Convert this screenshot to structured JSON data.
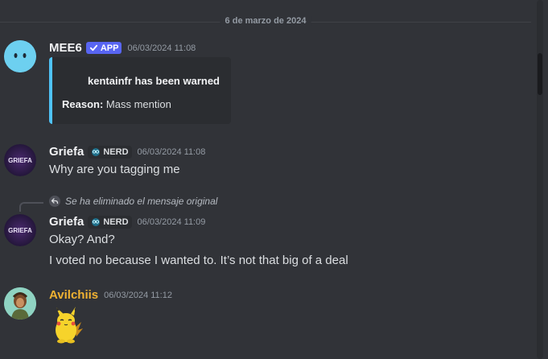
{
  "date_divider": "6 de marzo de 2024",
  "colors": {
    "background": "#313338",
    "embed_accent": "#4fc3f7",
    "app_badge": "#5865f2",
    "avilchiis_name": "#f0b232"
  },
  "messages": [
    {
      "author": "MEE6",
      "badge": "APP",
      "badge_icon": "check-icon",
      "timestamp": "06/03/2024 11:08",
      "embed": {
        "title": "kentainfr has been warned",
        "field_name": "Reason:",
        "field_value": "Mass mention"
      }
    },
    {
      "author": "Griefa",
      "avatar_text": "GRIEFA",
      "tag": "NERD",
      "tag_icon": "nerd-icon",
      "timestamp": "06/03/2024 11:08",
      "text": "Why are you tagging me"
    },
    {
      "reply_reference": "Se ha eliminado el mensaje original",
      "author": "Griefa",
      "avatar_text": "GRIEFA",
      "tag": "NERD",
      "tag_icon": "nerd-icon",
      "timestamp": "06/03/2024 11:09",
      "lines": [
        "Okay? And?",
        "I voted no because I wanted to. It’s not that big of a deal"
      ]
    },
    {
      "author": "Avilchiis",
      "timestamp": "06/03/2024 11:12",
      "sticker": "pikachu-sticker"
    }
  ]
}
